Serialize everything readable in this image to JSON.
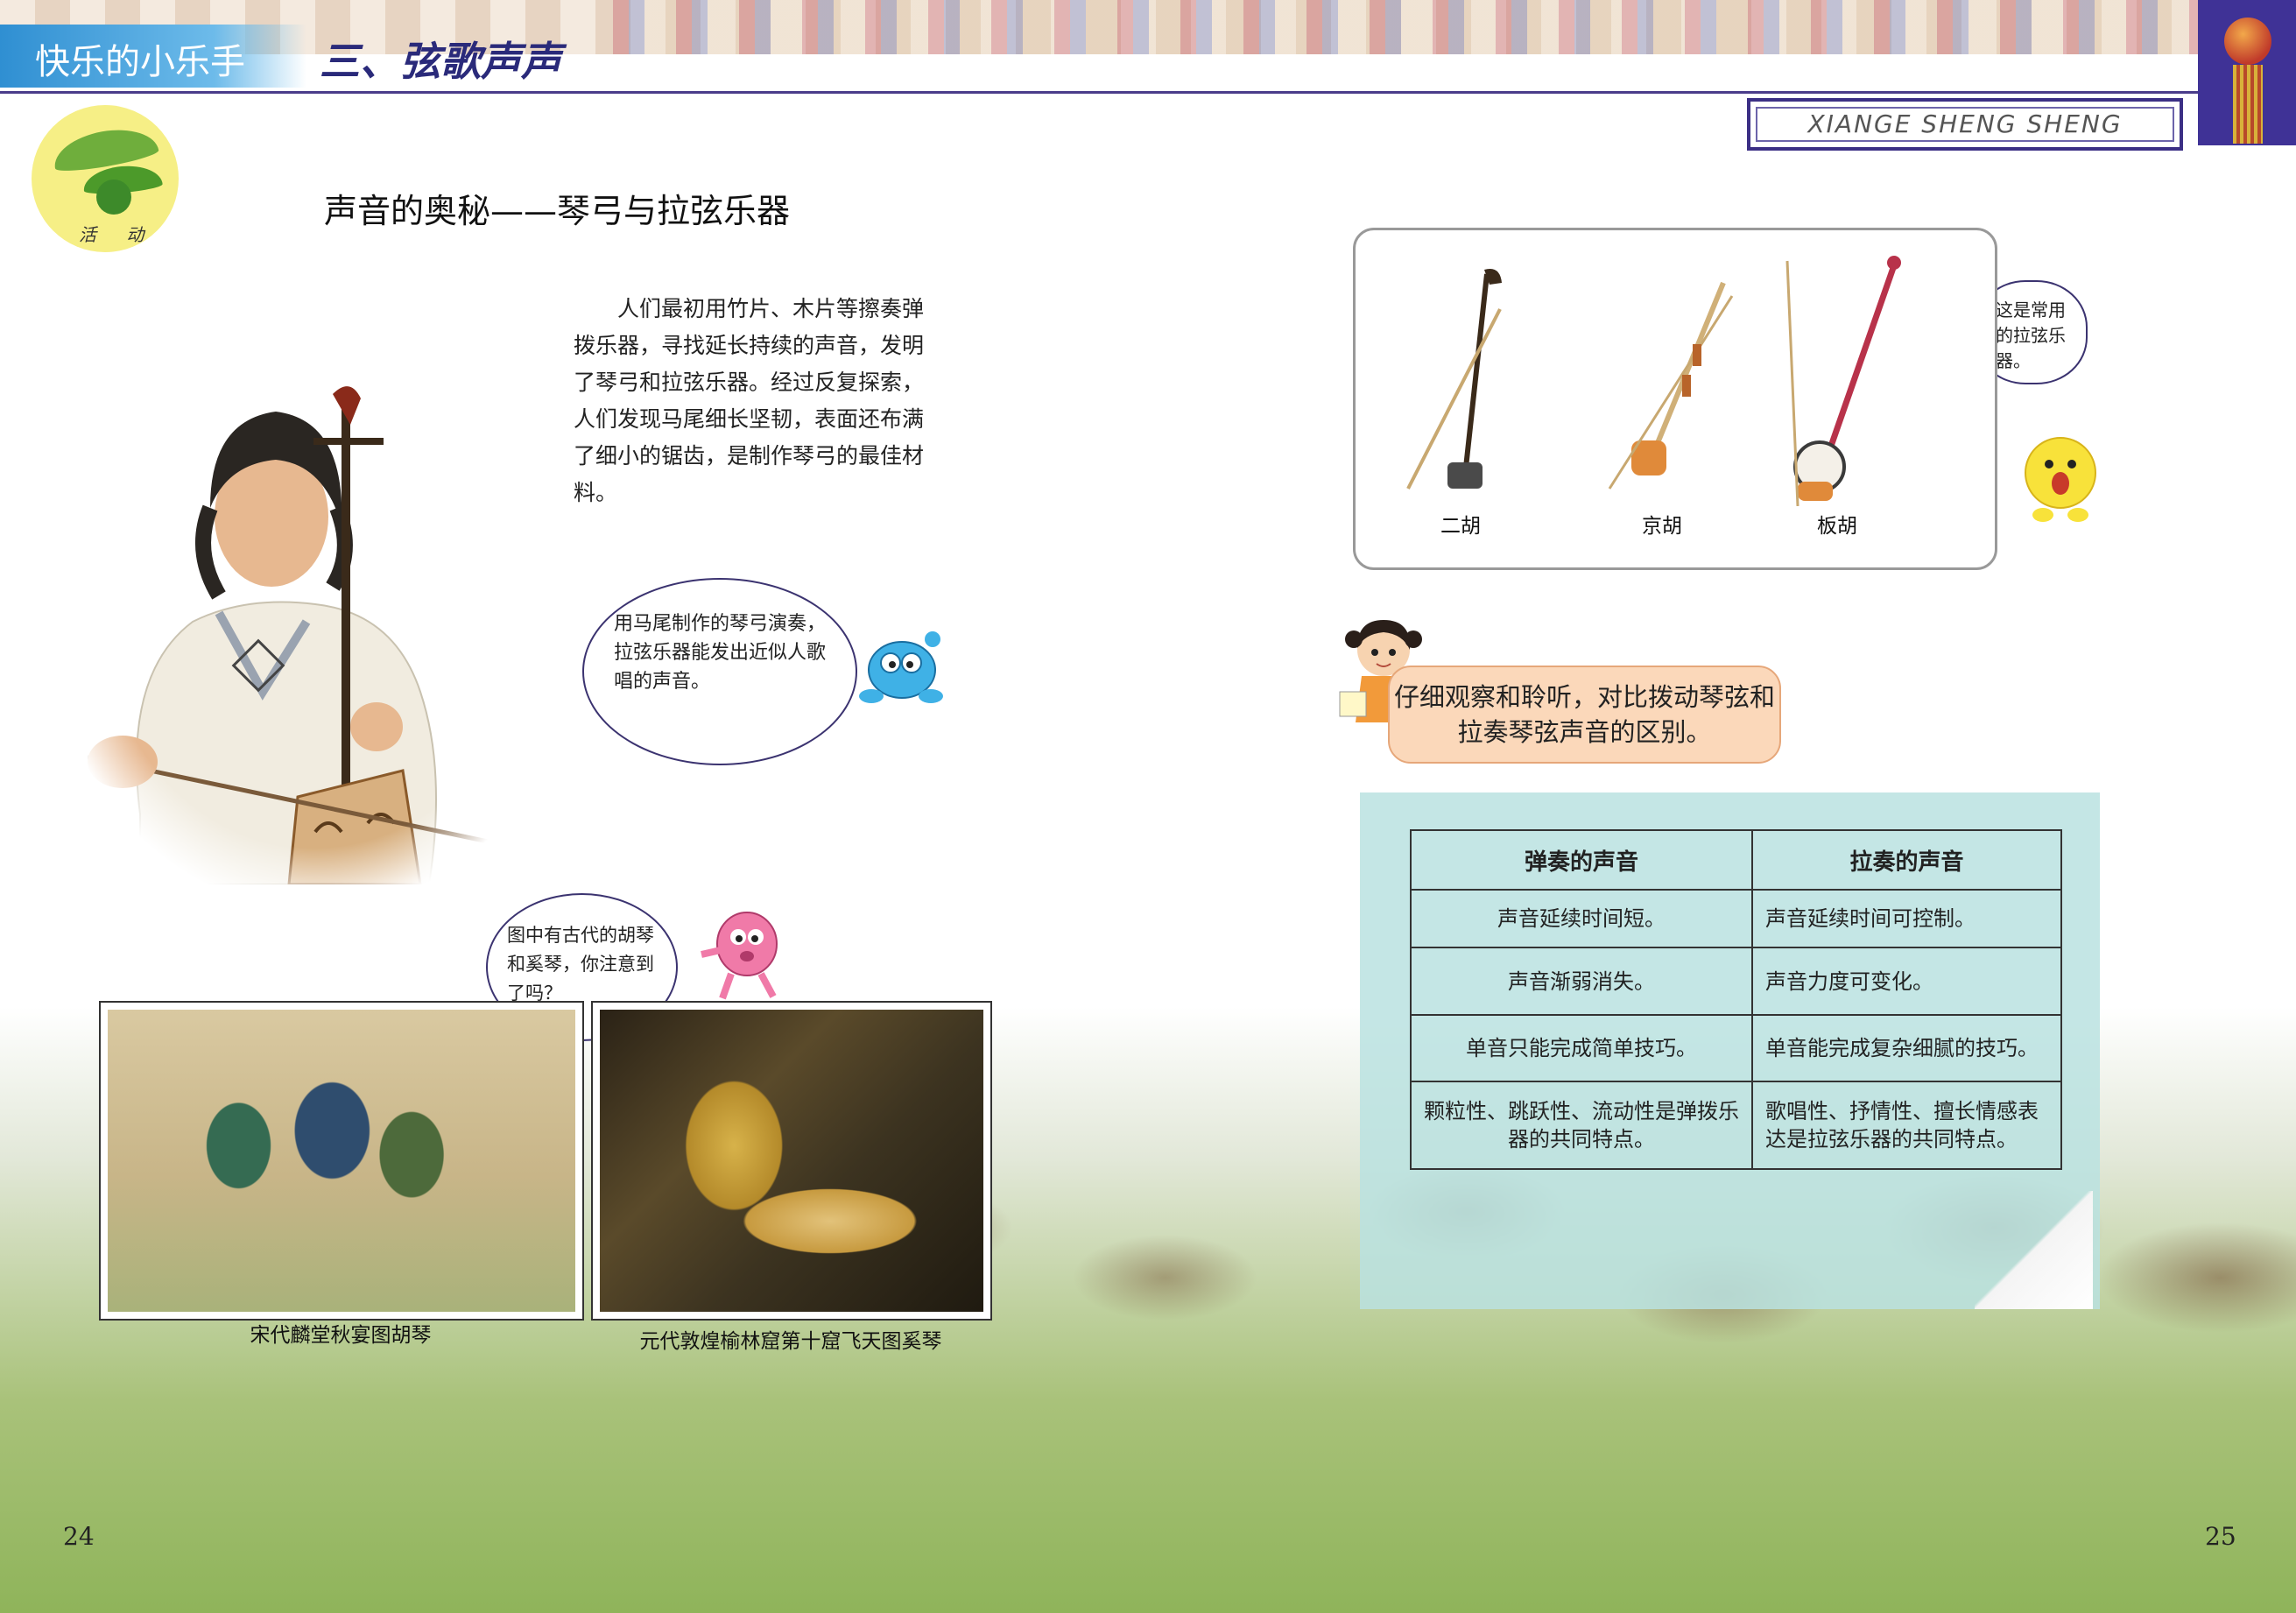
{
  "header": {
    "series_tab": "快乐的小乐手",
    "unit_title": "三、弦歌声声",
    "pinyin": "XIANGE SHENG SHENG"
  },
  "activity_badge": {
    "label": "活 动"
  },
  "section": {
    "title": "声音的奥秘——琴弓与拉弦乐器",
    "intro": "人们最初用竹片、木片等擦奏弹拨乐器，寻找延长持续的声音，发明了琴弓和拉弦乐器。经过反复探索，人们发现马尾细长坚韧，表面还布满了细小的锯齿，是制作琴弓的最佳材料。"
  },
  "bubbles": {
    "horsehair": "用马尾制作的琴弓演奏，拉弦乐器能发出近似人歌唱的声音。",
    "ancient": "图中有古代的胡琴和奚琴，你注意到了吗？",
    "common": "这是常用的拉弦乐器。"
  },
  "paintings": [
    {
      "caption": "宋代麟堂秋宴图胡琴"
    },
    {
      "caption": "元代敦煌榆林窟第十窟飞天图奚琴"
    }
  ],
  "instruments": [
    {
      "name": "二胡",
      "color": "#6a3a1a"
    },
    {
      "name": "京胡",
      "color": "#c08a3a"
    },
    {
      "name": "板胡",
      "color": "#b8324a"
    }
  ],
  "task": {
    "text": "仔细观察和聆听，对比拨动琴弦和拉奏琴弦声音的区别。"
  },
  "comparison_table": {
    "headers": [
      "弹奏的声音",
      "拉奏的声音"
    ],
    "rows": [
      [
        "声音延续时间短。",
        "声音延续时间可控制。"
      ],
      [
        "声音渐弱消失。",
        "声音力度可变化。"
      ],
      [
        "单音只能完成简单技巧。",
        "单音能完成复杂细腻的技巧。"
      ],
      [
        "颗粒性、跳跃性、流动性是弹拨乐器的共同特点。",
        "歌唱性、抒情性、擅长情感表达是拉弦乐器的共同特点。"
      ]
    ]
  },
  "page_numbers": {
    "left": "24",
    "right": "25"
  },
  "colors": {
    "header_tab": "#2f8fd2",
    "header_title": "#2a2a7a",
    "frame": "#3b2f85",
    "task_fill": "#fbd8ba",
    "table_panel": "#bae2e0"
  }
}
